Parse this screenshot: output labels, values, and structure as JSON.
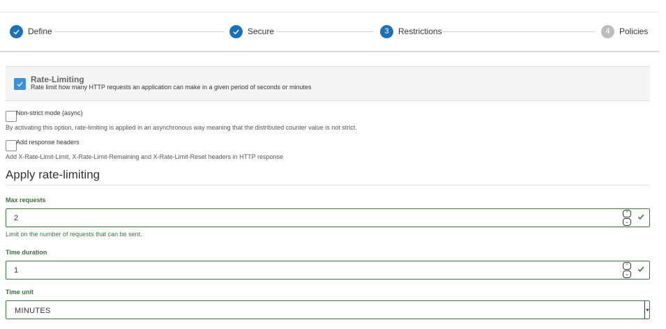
{
  "stepper": {
    "steps": [
      {
        "label": "Define",
        "marker": "",
        "state": "done"
      },
      {
        "label": "Secure",
        "marker": "",
        "state": "done"
      },
      {
        "label": "Restrictions",
        "marker": "3",
        "state": "active"
      },
      {
        "label": "Policies",
        "marker": "4",
        "state": "todo"
      }
    ]
  },
  "rate_limiting": {
    "title": "Rate-Limiting",
    "description": "Rate limit how many HTTP requests an application can make in a given period of seconds or minutes",
    "checked": true
  },
  "options": [
    {
      "label": "Non-strict mode (async)",
      "help": "By activating this option, rate-limiting is applied in an asynchronous way meaning that the distributed counter value is not strict.",
      "checked": false
    },
    {
      "label": "Add response headers",
      "help": "Add X-Rate-Limit-Limit, X-Rate-Limit-Remaining and X-Rate-Limit-Reset headers in HTTP response",
      "checked": false
    }
  ],
  "section": {
    "title": "Apply rate-limiting"
  },
  "form": {
    "max_requests": {
      "label": "Max requests",
      "value": "2",
      "help": "Limit on the number of requests that can be sent."
    },
    "time_duration": {
      "label": "Time duration",
      "value": "1"
    },
    "time_unit": {
      "label": "Time unit",
      "value": "MINUTES"
    }
  },
  "colors": {
    "primary": "#1d6fb8",
    "checkbox": "#3f8fd2",
    "success": "#3c763d",
    "inactive_step": "#bdbdbd"
  },
  "icons": {
    "step_done": "check-icon",
    "valid": "check-icon",
    "spinner_up": "chevron-up-icon",
    "spinner_down": "chevron-down-icon",
    "select_caret": "caret-down-icon"
  }
}
